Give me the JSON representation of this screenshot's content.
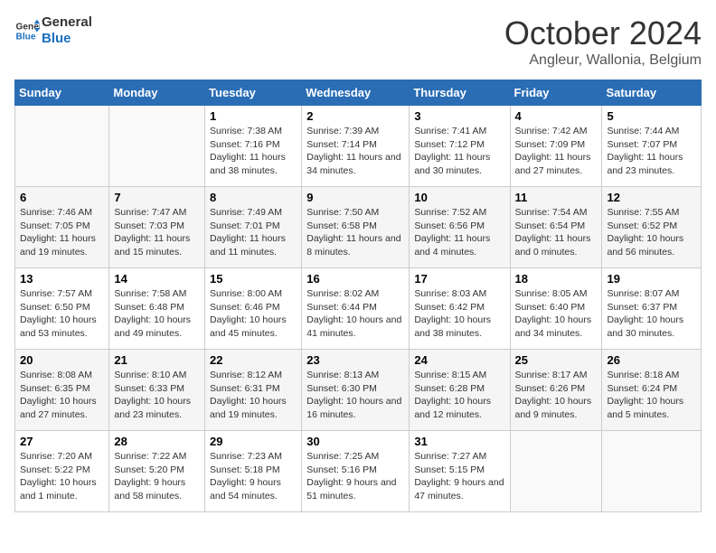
{
  "header": {
    "logo_line1": "General",
    "logo_line2": "Blue",
    "month": "October 2024",
    "location": "Angleur, Wallonia, Belgium"
  },
  "weekdays": [
    "Sunday",
    "Monday",
    "Tuesday",
    "Wednesday",
    "Thursday",
    "Friday",
    "Saturday"
  ],
  "weeks": [
    [
      {
        "day": "",
        "info": ""
      },
      {
        "day": "",
        "info": ""
      },
      {
        "day": "1",
        "info": "Sunrise: 7:38 AM\nSunset: 7:16 PM\nDaylight: 11 hours and 38 minutes."
      },
      {
        "day": "2",
        "info": "Sunrise: 7:39 AM\nSunset: 7:14 PM\nDaylight: 11 hours and 34 minutes."
      },
      {
        "day": "3",
        "info": "Sunrise: 7:41 AM\nSunset: 7:12 PM\nDaylight: 11 hours and 30 minutes."
      },
      {
        "day": "4",
        "info": "Sunrise: 7:42 AM\nSunset: 7:09 PM\nDaylight: 11 hours and 27 minutes."
      },
      {
        "day": "5",
        "info": "Sunrise: 7:44 AM\nSunset: 7:07 PM\nDaylight: 11 hours and 23 minutes."
      }
    ],
    [
      {
        "day": "6",
        "info": "Sunrise: 7:46 AM\nSunset: 7:05 PM\nDaylight: 11 hours and 19 minutes."
      },
      {
        "day": "7",
        "info": "Sunrise: 7:47 AM\nSunset: 7:03 PM\nDaylight: 11 hours and 15 minutes."
      },
      {
        "day": "8",
        "info": "Sunrise: 7:49 AM\nSunset: 7:01 PM\nDaylight: 11 hours and 11 minutes."
      },
      {
        "day": "9",
        "info": "Sunrise: 7:50 AM\nSunset: 6:58 PM\nDaylight: 11 hours and 8 minutes."
      },
      {
        "day": "10",
        "info": "Sunrise: 7:52 AM\nSunset: 6:56 PM\nDaylight: 11 hours and 4 minutes."
      },
      {
        "day": "11",
        "info": "Sunrise: 7:54 AM\nSunset: 6:54 PM\nDaylight: 11 hours and 0 minutes."
      },
      {
        "day": "12",
        "info": "Sunrise: 7:55 AM\nSunset: 6:52 PM\nDaylight: 10 hours and 56 minutes."
      }
    ],
    [
      {
        "day": "13",
        "info": "Sunrise: 7:57 AM\nSunset: 6:50 PM\nDaylight: 10 hours and 53 minutes."
      },
      {
        "day": "14",
        "info": "Sunrise: 7:58 AM\nSunset: 6:48 PM\nDaylight: 10 hours and 49 minutes."
      },
      {
        "day": "15",
        "info": "Sunrise: 8:00 AM\nSunset: 6:46 PM\nDaylight: 10 hours and 45 minutes."
      },
      {
        "day": "16",
        "info": "Sunrise: 8:02 AM\nSunset: 6:44 PM\nDaylight: 10 hours and 41 minutes."
      },
      {
        "day": "17",
        "info": "Sunrise: 8:03 AM\nSunset: 6:42 PM\nDaylight: 10 hours and 38 minutes."
      },
      {
        "day": "18",
        "info": "Sunrise: 8:05 AM\nSunset: 6:40 PM\nDaylight: 10 hours and 34 minutes."
      },
      {
        "day": "19",
        "info": "Sunrise: 8:07 AM\nSunset: 6:37 PM\nDaylight: 10 hours and 30 minutes."
      }
    ],
    [
      {
        "day": "20",
        "info": "Sunrise: 8:08 AM\nSunset: 6:35 PM\nDaylight: 10 hours and 27 minutes."
      },
      {
        "day": "21",
        "info": "Sunrise: 8:10 AM\nSunset: 6:33 PM\nDaylight: 10 hours and 23 minutes."
      },
      {
        "day": "22",
        "info": "Sunrise: 8:12 AM\nSunset: 6:31 PM\nDaylight: 10 hours and 19 minutes."
      },
      {
        "day": "23",
        "info": "Sunrise: 8:13 AM\nSunset: 6:30 PM\nDaylight: 10 hours and 16 minutes."
      },
      {
        "day": "24",
        "info": "Sunrise: 8:15 AM\nSunset: 6:28 PM\nDaylight: 10 hours and 12 minutes."
      },
      {
        "day": "25",
        "info": "Sunrise: 8:17 AM\nSunset: 6:26 PM\nDaylight: 10 hours and 9 minutes."
      },
      {
        "day": "26",
        "info": "Sunrise: 8:18 AM\nSunset: 6:24 PM\nDaylight: 10 hours and 5 minutes."
      }
    ],
    [
      {
        "day": "27",
        "info": "Sunrise: 7:20 AM\nSunset: 5:22 PM\nDaylight: 10 hours and 1 minute."
      },
      {
        "day": "28",
        "info": "Sunrise: 7:22 AM\nSunset: 5:20 PM\nDaylight: 9 hours and 58 minutes."
      },
      {
        "day": "29",
        "info": "Sunrise: 7:23 AM\nSunset: 5:18 PM\nDaylight: 9 hours and 54 minutes."
      },
      {
        "day": "30",
        "info": "Sunrise: 7:25 AM\nSunset: 5:16 PM\nDaylight: 9 hours and 51 minutes."
      },
      {
        "day": "31",
        "info": "Sunrise: 7:27 AM\nSunset: 5:15 PM\nDaylight: 9 hours and 47 minutes."
      },
      {
        "day": "",
        "info": ""
      },
      {
        "day": "",
        "info": ""
      }
    ]
  ]
}
